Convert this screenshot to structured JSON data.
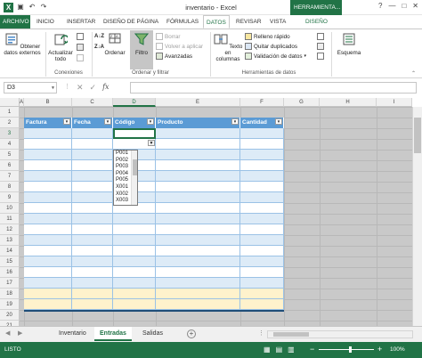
{
  "window": {
    "title": "inventario - Excel",
    "contextual_tab": "HERRAMIENTA...",
    "controls": [
      "?",
      "—",
      "□",
      "✕"
    ]
  },
  "tabs": [
    "ARCHIVO",
    "INICIO",
    "INSERTAR",
    "DISEÑO DE PÁGINA",
    "FÓRMULAS",
    "DATOS",
    "REVISAR",
    "VISTA",
    "DISEÑO"
  ],
  "ribbon": {
    "get_external": "Obtener datos externos",
    "refresh_all": "Actualizar todo",
    "group_connections": "Conexiones",
    "sort": "Ordenar",
    "filter": "Filtro",
    "clear": "Borrar",
    "reapply": "Volver a aplicar",
    "advanced": "Avanzadas",
    "group_sort_filter": "Ordenar y filtrar",
    "text_to_columns": "Texto en columnas",
    "flash_fill": "Relleno rápido",
    "remove_duplicates": "Quitar duplicados",
    "data_validation": "Validación de datos",
    "group_data_tools": "Herramientas de datos",
    "outline": "Esquema"
  },
  "formula_bar": {
    "name_box": "D3",
    "fx": "fx",
    "value": ""
  },
  "grid": {
    "columns": [
      "A",
      "B",
      "C",
      "D",
      "E",
      "F",
      "G",
      "H",
      "I"
    ],
    "selected_column": "D",
    "rows": [
      "1",
      "2",
      "3",
      "4",
      "5",
      "6",
      "7",
      "8",
      "9",
      "10",
      "11",
      "12",
      "13",
      "14",
      "15",
      "16",
      "17",
      "18",
      "19",
      "20",
      "21"
    ],
    "selected_row": "3",
    "table_headers": [
      "Factura",
      "Fecha",
      "Código",
      "Producto",
      "Cantidad"
    ]
  },
  "dropdown": {
    "options": [
      "P001",
      "P002",
      "P003",
      "P004",
      "P005",
      "X001",
      "X002",
      "X003"
    ]
  },
  "sheets": {
    "tabs": [
      "Inventario",
      "Entradas",
      "Salidas"
    ],
    "active": "Entradas",
    "add": "+"
  },
  "status": {
    "text": "LISTO",
    "zoom_minus": "−",
    "zoom_plus": "+",
    "zoom": "100%"
  },
  "colors": {
    "excel_green": "#217346",
    "table_header": "#5b9bd5",
    "band_light": "#ddebf7",
    "band_white": "#ffffff",
    "total_row": "#fff2cc"
  }
}
